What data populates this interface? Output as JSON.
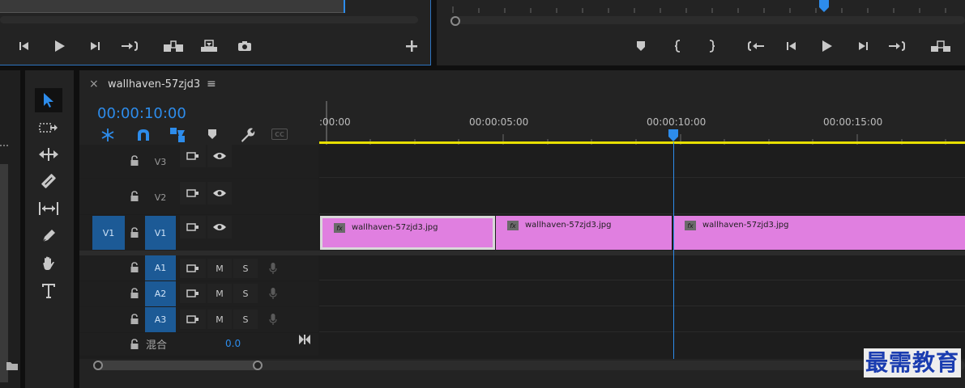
{
  "timeline": {
    "sequence_name": "wallhaven-57zjd3",
    "close_symbol": "×",
    "menu_symbol": "≡",
    "current_timecode": "00:00:10:00",
    "ruler_labels": [
      ":00:00",
      "00:00:05:00",
      "00:00:10:00",
      "00:00:15:00"
    ],
    "video_tracks": [
      {
        "label": "V3"
      },
      {
        "label": "V2"
      },
      {
        "label": "V1",
        "source_patch": "V1"
      }
    ],
    "audio_tracks": [
      {
        "label": "A1",
        "mute": "M",
        "solo": "S"
      },
      {
        "label": "A2",
        "mute": "M",
        "solo": "S"
      },
      {
        "label": "A3",
        "mute": "M",
        "solo": "S"
      }
    ],
    "mix": {
      "label": "混合",
      "value": "0.0"
    },
    "cc_label": "CC",
    "clips": [
      {
        "name": "wallhaven-57zjd3.jpg",
        "fx": "fx"
      },
      {
        "name": "wallhaven-57zjd3.jpg",
        "fx": "fx"
      },
      {
        "name": "wallhaven-57zjd3.jpg",
        "fx": "fx"
      }
    ]
  },
  "watermark": "最需教育",
  "colors": {
    "clip": "#e07fe0",
    "accent_blue": "#2d8ceb",
    "work_area": "#e8e000",
    "track_target": "#1c5a96"
  }
}
